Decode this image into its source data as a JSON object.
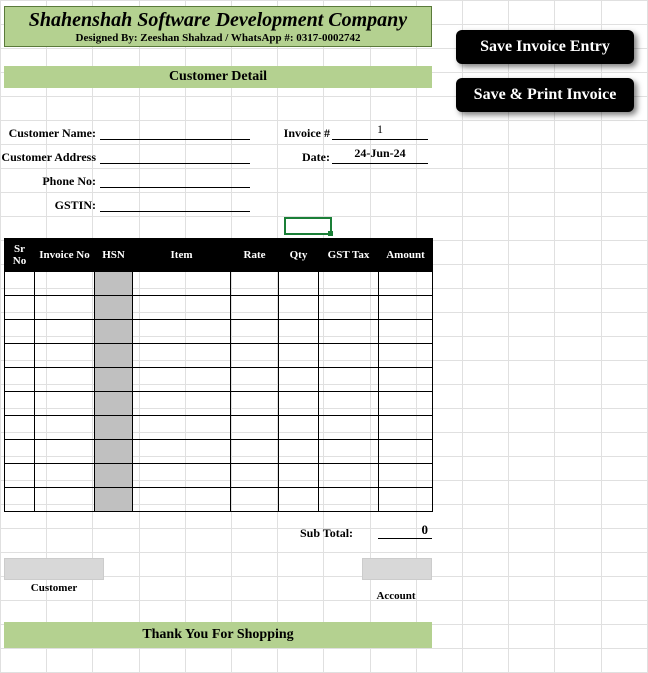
{
  "header": {
    "company": "Shahenshah Software Development Company",
    "designed_by": "Designed By: Zeeshan Shahzad / WhatsApp #: 0317-0002742"
  },
  "sections": {
    "customer_detail": "Customer Detail",
    "thanks": "Thank You For Shopping"
  },
  "buttons": {
    "save": "Save Invoice Entry",
    "print": "Save & Print Invoice"
  },
  "labels": {
    "customer_name": "Customer Name:",
    "customer_address": "Customer Address",
    "phone_no": "Phone No:",
    "gstin": "GSTIN:",
    "invoice_no": "Invoice #",
    "date": "Date:",
    "subtotal": "Sub Total:",
    "customer": "Customer",
    "account": "Account"
  },
  "values": {
    "customer_name": "",
    "customer_address": "",
    "phone_no": "",
    "gstin": "",
    "invoice_no": "1",
    "date": "24-Jun-24",
    "subtotal": "0"
  },
  "columns": {
    "sr": "Sr No",
    "inv": "Invoice No",
    "hsn": "HSN",
    "item": "Item",
    "rate": "Rate",
    "qty": "Qty",
    "gst": "GST Tax",
    "amt": "Amount"
  },
  "rows": [
    {
      "sr": "",
      "inv": "",
      "hsn": "",
      "item": "",
      "rate": "",
      "qty": "",
      "gst": "",
      "amt": ""
    },
    {
      "sr": "",
      "inv": "",
      "hsn": "",
      "item": "",
      "rate": "",
      "qty": "",
      "gst": "",
      "amt": ""
    },
    {
      "sr": "",
      "inv": "",
      "hsn": "",
      "item": "",
      "rate": "",
      "qty": "",
      "gst": "",
      "amt": ""
    },
    {
      "sr": "",
      "inv": "",
      "hsn": "",
      "item": "",
      "rate": "",
      "qty": "",
      "gst": "",
      "amt": ""
    },
    {
      "sr": "",
      "inv": "",
      "hsn": "",
      "item": "",
      "rate": "",
      "qty": "",
      "gst": "",
      "amt": ""
    },
    {
      "sr": "",
      "inv": "",
      "hsn": "",
      "item": "",
      "rate": "",
      "qty": "",
      "gst": "",
      "amt": ""
    },
    {
      "sr": "",
      "inv": "",
      "hsn": "",
      "item": "",
      "rate": "",
      "qty": "",
      "gst": "",
      "amt": ""
    },
    {
      "sr": "",
      "inv": "",
      "hsn": "",
      "item": "",
      "rate": "",
      "qty": "",
      "gst": "",
      "amt": ""
    },
    {
      "sr": "",
      "inv": "",
      "hsn": "",
      "item": "",
      "rate": "",
      "qty": "",
      "gst": "",
      "amt": ""
    },
    {
      "sr": "",
      "inv": "",
      "hsn": "",
      "item": "",
      "rate": "",
      "qty": "",
      "gst": "",
      "amt": ""
    }
  ]
}
